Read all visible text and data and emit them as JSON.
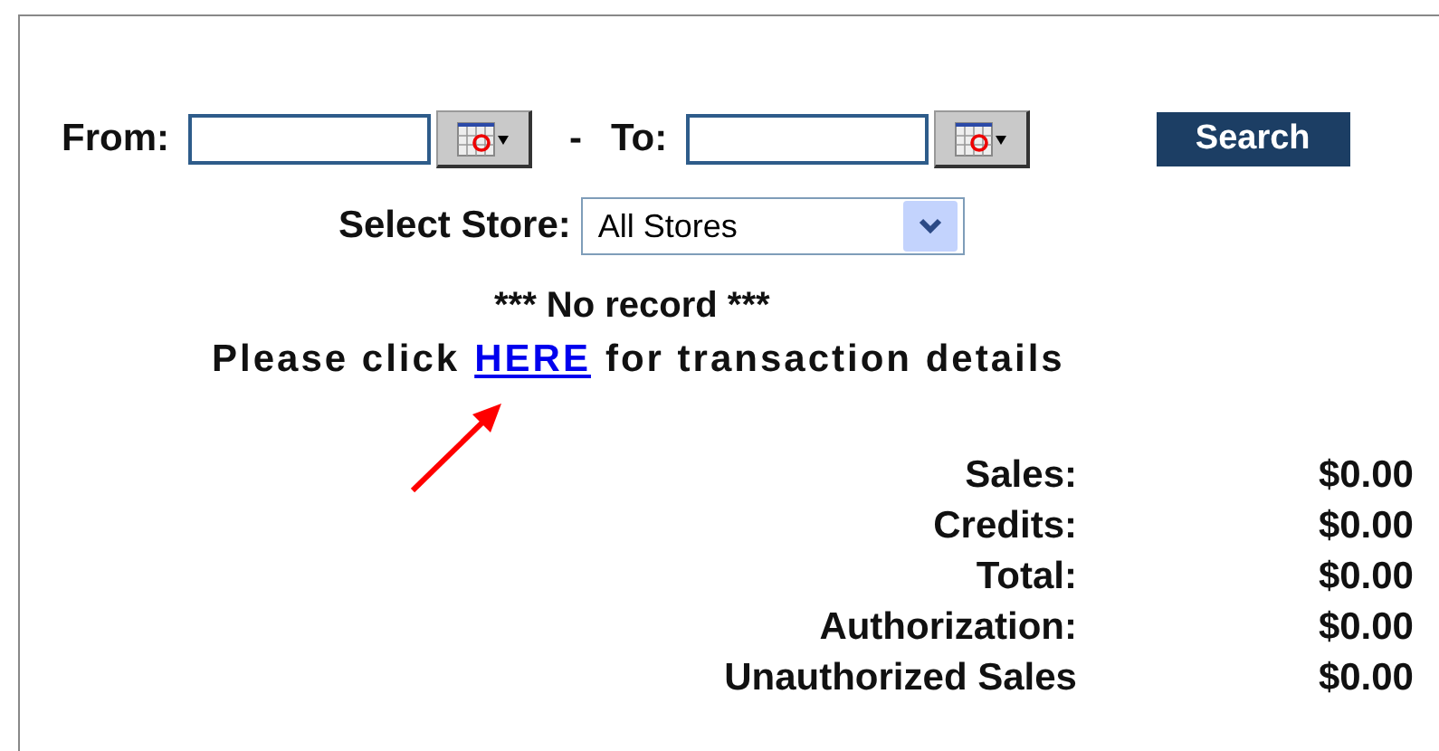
{
  "date_range": {
    "from_label": "From:",
    "separator": "-",
    "to_label": "To:"
  },
  "search_button": "Search",
  "store": {
    "label": "Select Store:",
    "value": "All Stores"
  },
  "message": "*** No record ***",
  "details": {
    "before": "Please click",
    "link": "HERE",
    "after": "for transaction details"
  },
  "totals": [
    {
      "label": "Sales:",
      "value": "$0.00"
    },
    {
      "label": "Credits:",
      "value": "$0.00"
    },
    {
      "label": "Total:",
      "value": "$0.00"
    },
    {
      "label": "Authorization:",
      "value": "$0.00"
    },
    {
      "label": "Unauthorized Sales",
      "value": "$0.00"
    }
  ]
}
